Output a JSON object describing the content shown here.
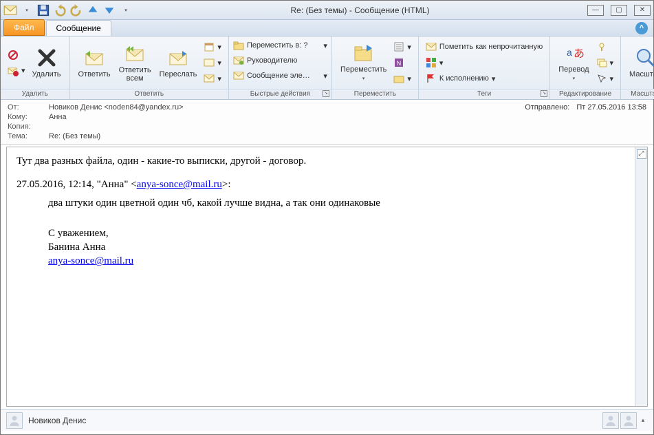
{
  "window": {
    "title": "Re: (Без темы)  -  Сообщение (HTML)"
  },
  "tabs": {
    "file": "Файл",
    "message": "Сообщение"
  },
  "ribbon": {
    "delete": {
      "ignore": "",
      "junk": "",
      "delete": "Удалить",
      "group": "Удалить"
    },
    "respond": {
      "reply": "Ответить",
      "reply_all": "Ответить\nвсем",
      "forward": "Переслать",
      "more": "",
      "group": "Ответить"
    },
    "quicksteps": {
      "move_to": "Переместить в: ?",
      "manager": "Руководителю",
      "team_email": "Сообщение эле…",
      "group": "Быстрые действия"
    },
    "move": {
      "move": "Переместить",
      "rules": "",
      "onenote": "",
      "actions": "",
      "group": "Переместить"
    },
    "tags": {
      "mark_unread": "Пометить как непрочитанную",
      "follow_up": "К исполнению",
      "categorize": "",
      "group": "Теги"
    },
    "editing": {
      "translate": "Перевод",
      "find": "",
      "related": "",
      "select": "",
      "group": "Редактирование"
    },
    "zoom": {
      "zoom": "Масштаб",
      "group": "Масштаб"
    }
  },
  "header": {
    "from_label": "От:",
    "from_value": "Новиков Денис <noden84@yandex.ru>",
    "to_label": "Кому:",
    "to_value": "Анна",
    "cc_label": "Копия:",
    "cc_value": "",
    "subj_label": "Тема:",
    "subj_value": "Re: (Без темы)",
    "sent_label": "Отправлено:",
    "sent_value": "Пт 27.05.2016 13:58"
  },
  "body": {
    "line1": "Тут два разных файла, один - какие-то выписки, другой - договор.",
    "quote_header_pre": "27.05.2016, 12:14, \"Анна\" <",
    "quote_header_link": "anya-sonce@mail.ru",
    "quote_header_post": ">:",
    "quote_line": "два штуки один цветной один чб, какой лучше видна, а так они одинаковые",
    "sig1": "С уважением,",
    "sig2": "Банина Анна",
    "sig_mail": "anya-sonce@mail.ru"
  },
  "footer": {
    "name": "Новиков Денис"
  }
}
